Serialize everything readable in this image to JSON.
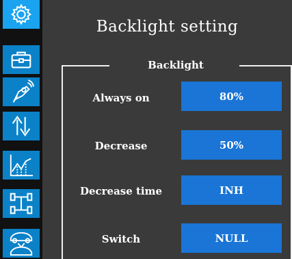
{
  "sidebar": {
    "items": [
      {
        "icon": "gear-icon",
        "active": true
      },
      {
        "icon": "toolbox-icon"
      },
      {
        "icon": "transmitter-icon"
      },
      {
        "icon": "reverse-arrows-icon"
      },
      {
        "icon": "chart-icon"
      },
      {
        "icon": "chassis-icon"
      },
      {
        "icon": "car-swap-icon"
      }
    ]
  },
  "header": {
    "title": "Backlight setting"
  },
  "group": {
    "legend": "Backlight",
    "rows": [
      {
        "label": "Always on",
        "value": "80%"
      },
      {
        "label": "Decrease",
        "value": "50%"
      },
      {
        "label": "Decrease time",
        "value": "INH"
      },
      {
        "label": "Switch",
        "value": "NULL"
      }
    ]
  },
  "colors": {
    "background": "#3a3a3a",
    "sidebar": "#111111",
    "nav_icon": "#0b82c8",
    "nav_active": "#19a3f0",
    "value_button": "#1a75d6"
  }
}
